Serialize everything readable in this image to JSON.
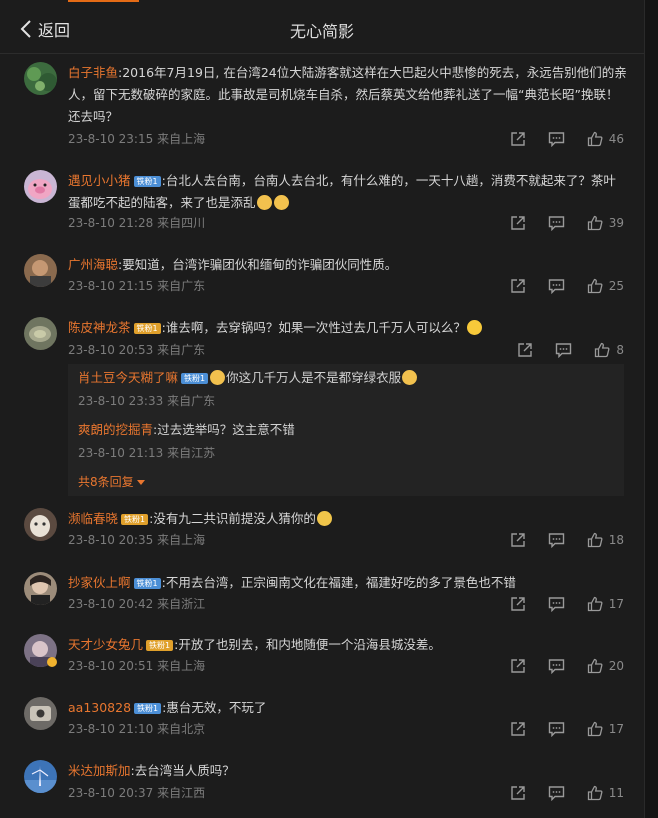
{
  "header": {
    "back_label": "返回",
    "title": "无心简影"
  },
  "comments": [
    {
      "name": "白子非鱼",
      "badge": "",
      "text": ":2016年7月19日, 在台湾24位大陆游客就这样在大巴起火中悲惨的死去，永远告别他们的亲人，留下无数破碎的家庭。此事故是司机烧车自杀，然后蔡英文给他葬礼送了一幅“典范长昭”挽联！还去吗？",
      "time": "23-8-10 23:15",
      "location": "来自上海",
      "likes": "46"
    },
    {
      "name": "遇见小小猪",
      "badge": "铁粉1",
      "text": ":台北人去台南，台南人去台北，有什么难的，一天十八趟，消费不就起来了？茶叶蛋都吃不起的陆客，来了也是添乱",
      "time": "23-8-10 21:28",
      "location": "来自四川",
      "likes": "39"
    },
    {
      "name": "广州海聪",
      "badge": "",
      "text": ":要知道，台湾诈骗团伙和缅甸的诈骗团伙同性质。",
      "time": "23-8-10 21:15",
      "location": "来自广东",
      "likes": "25"
    },
    {
      "name": "陈皮神龙茶",
      "badge": "铁粉1",
      "text": ":谁去啊，去穿锅吗？如果一次性过去几千万人可以么？",
      "time": "23-8-10 20:53",
      "location": "来自广东",
      "likes": "8",
      "replies": [
        {
          "name": "肖土豆今天糊了嘛",
          "badge": "铁粉1",
          "text": "你这几千万人是不是都穿绿衣服",
          "time": "23-8-10 23:33",
          "location": "来自广东"
        },
        {
          "name": "爽朗的挖掘青",
          "badge": "",
          "text": ":过去选举吗？这主意不错",
          "time": "23-8-10 21:13",
          "location": "来自江苏"
        }
      ],
      "more_label": "共8条回复"
    },
    {
      "name": "濒临春晓",
      "badge": "铁粉1",
      "text": ":没有九二共识前提没人猜你的",
      "time": "23-8-10 20:35",
      "location": "来自上海",
      "likes": "18"
    },
    {
      "name": "抄家伙上啊",
      "badge": "铁粉1",
      "text": ":不用去台湾，正宗闽南文化在福建，福建好吃的多了景色也不错",
      "time": "23-8-10 20:42",
      "location": "来自浙江",
      "likes": "17"
    },
    {
      "name": "天才少女兔几",
      "badge": "铁粉1",
      "text": ":开放了也别去，和内地随便一个沿海县城没差。",
      "time": "23-8-10 20:51",
      "location": "来自上海",
      "likes": "20"
    },
    {
      "name": "aa130828",
      "badge": "铁粉1",
      "text": ":惠台无效，不玩了",
      "time": "23-8-10 21:10",
      "location": "来自北京",
      "likes": "17"
    },
    {
      "name": "米达加斯加",
      "badge": "",
      "text": ":去台湾当人质吗？",
      "time": "23-8-10 20:37",
      "location": "来自江西",
      "likes": "11"
    }
  ],
  "colors": {
    "accent": "#e8762f",
    "background": "#1c1c1c",
    "badge_blue": "#4c8fd6",
    "badge_gold": "#e0a02b"
  },
  "icons": {
    "back": "chevron-left-icon",
    "share": "share-icon",
    "comment": "comment-icon",
    "like": "thumbs-up-icon"
  }
}
